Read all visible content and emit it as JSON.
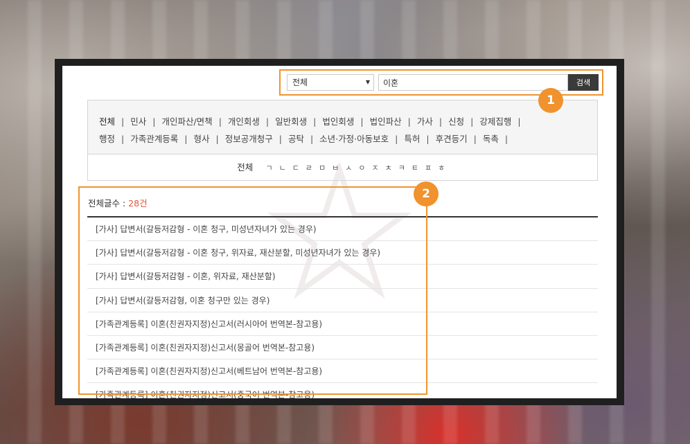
{
  "search": {
    "scope_selected": "전체",
    "query": "이혼",
    "button_label": "검색"
  },
  "annotations": {
    "badge1": "1",
    "badge2": "2"
  },
  "categories": [
    [
      "전체",
      "민사",
      "개인파산/면책",
      "개인회생",
      "일반회생",
      "법인회생",
      "법인파산",
      "가사",
      "신청",
      "강제집행"
    ],
    [
      "행정",
      "가족관계등록",
      "형사",
      "정보공개청구",
      "공탁",
      "소년·가정·아동보호",
      "특허",
      "후견등기",
      "독촉"
    ]
  ],
  "alpha_filter": {
    "all_label": "전체",
    "letters": [
      "ㄱ",
      "ㄴ",
      "ㄷ",
      "ㄹ",
      "ㅁ",
      "ㅂ",
      "ㅅ",
      "ㅇ",
      "ㅈ",
      "ㅊ",
      "ㅋ",
      "ㅌ",
      "ㅍ",
      "ㅎ"
    ]
  },
  "results": {
    "count_label": "전체글수 : ",
    "count_value": "28건",
    "items": [
      "[가사] 답변서(갈등저감형 - 이혼 청구, 미성년자녀가 있는 경우)",
      "[가사] 답변서(갈등저감형 - 이혼 청구, 위자료, 재산분할, 미성년자녀가 있는 경우)",
      "[가사] 답변서(갈등저감형 - 이혼, 위자료, 재산분할)",
      "[가사] 답변서(갈등저감형, 이혼 청구만 있는 경우)",
      "[가족관계등록] 이혼(친권자지정)신고서(러시아어 번역본-참고용)",
      "[가족관계등록] 이혼(친권자지정)신고서(몽골어 번역본-참고용)",
      "[가족관계등록] 이혼(친권자지정)신고서(베트남어 번역본-참고용)",
      "[가족관계등록] 이혼(친권자지정)신고서(중국어 번역본-참고용)"
    ]
  },
  "colors": {
    "accent_orange": "#f0942d",
    "count_red": "#e2553b",
    "button_dark": "#3a3a3a"
  }
}
